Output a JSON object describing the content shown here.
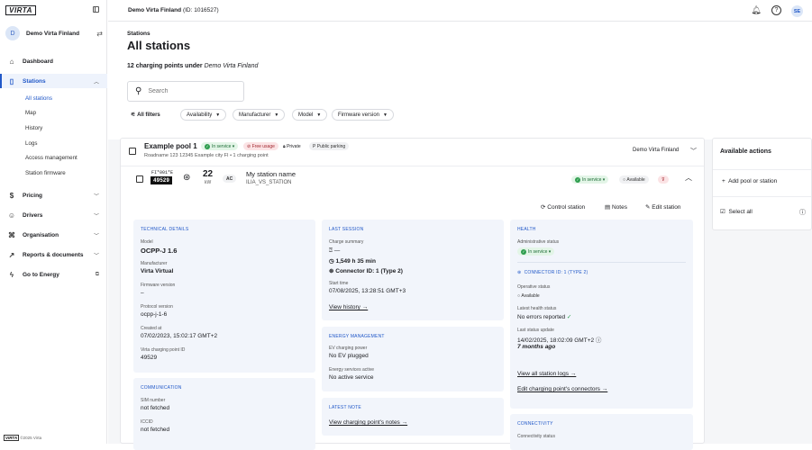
{
  "sidebar": {
    "logo": "VIRTA",
    "org_initial": "D",
    "org_name": "Demo Virta Finland",
    "nav": [
      {
        "label": "Dashboard",
        "icon": "dashboard-icon"
      },
      {
        "label": "Stations",
        "icon": "stations-icon"
      },
      {
        "label": "Pricing",
        "icon": "pricing-icon"
      },
      {
        "label": "Drivers",
        "icon": "drivers-icon"
      },
      {
        "label": "Organisation",
        "icon": "organisation-icon"
      },
      {
        "label": "Reports & documents",
        "icon": "reports-icon"
      },
      {
        "label": "Go to Energy",
        "icon": "energy-icon"
      }
    ],
    "sub": [
      "All stations",
      "Map",
      "History",
      "Logs",
      "Access management",
      "Station firmware"
    ],
    "footer_logo": "VIRTA",
    "footer_text": "©2025 Virta"
  },
  "topbar": {
    "org": "Demo Virta Finland",
    "id": "(ID: 1016527)",
    "avatar": "SE"
  },
  "page": {
    "breadcrumb": "Stations",
    "title": "All stations",
    "count_prefix": "12 charging points under ",
    "count_org": "Demo Virta Finland",
    "search_placeholder": "Search",
    "filters": [
      "All filters",
      "Availability",
      "Manufacturer",
      "Model",
      "Firmware version"
    ]
  },
  "pool": {
    "name": "Example pool 1",
    "status": "In service",
    "usage": "Free usage",
    "privacy": "Private",
    "parking": "Public parking",
    "address": "Roadname 123 12345 Example city FI • 1 charging point",
    "owner": "Demo Virta Finland"
  },
  "station": {
    "code_top": "FI*001*E",
    "code": "49529",
    "power": "22",
    "power_unit": "kW",
    "type": "AC",
    "name": "My station name",
    "subname": "ILIA_VS_STATION",
    "status": "In service",
    "availability": "Available",
    "actions": [
      "Control station",
      "Notes",
      "Edit station"
    ]
  },
  "technical": {
    "header": "TECHNICAL DETAILS",
    "model_label": "Model",
    "model": "OCPP-J 1.6",
    "manufacturer_label": "Manufacturer",
    "manufacturer": "Virta Virtual",
    "firmware_label": "Firmware version",
    "firmware": "–",
    "protocol_label": "Protocol version",
    "protocol": "ocpp-j-1-6",
    "created_label": "Created at",
    "created": "07/02/2023, 15:02:17 GMT+2",
    "cpid_label": "Virta charging point ID",
    "cpid": "49529"
  },
  "communication": {
    "header": "COMMUNICATION",
    "sim_label": "SIM number",
    "sim": "not fetched",
    "iccid_label": "ICCID",
    "iccid": "not fetched"
  },
  "last_session": {
    "header": "LAST SESSION",
    "summary_label": "Charge summary",
    "energy": "—",
    "duration": "1,549 h 35 min",
    "connector": "Connector ID: 1 (Type 2)",
    "start_label": "Start time",
    "start": "07/08/2025, 13:28:51 GMT+3",
    "history_link": "View history →"
  },
  "energy": {
    "header": "ENERGY MANAGEMENT",
    "power_label": "EV charging power",
    "power": "No EV plugged",
    "services_label": "Energy services active",
    "services": "No active service"
  },
  "note": {
    "header": "LATEST NOTE",
    "link": "View charging point's notes →"
  },
  "health": {
    "header": "HEALTH",
    "admin_label": "Administrative status",
    "admin": "In service",
    "connector_header": "CONNECTOR ID: 1 (TYPE 2)",
    "op_label": "Operative status",
    "op": "Available",
    "health_label": "Latest health status",
    "health": "No errors reported",
    "update_label": "Last status update",
    "update": "14/02/2025, 18:02:09 GMT+2",
    "update_ago": "7 months ago",
    "logs_link": "View all station logs →",
    "connectors_link": "Edit charging point's connectors →"
  },
  "connectivity": {
    "header": "CONNECTIVITY",
    "status_label": "Connectivity status"
  },
  "actions": {
    "title": "Available actions",
    "add": "Add pool or station",
    "select_all": "Select all"
  }
}
